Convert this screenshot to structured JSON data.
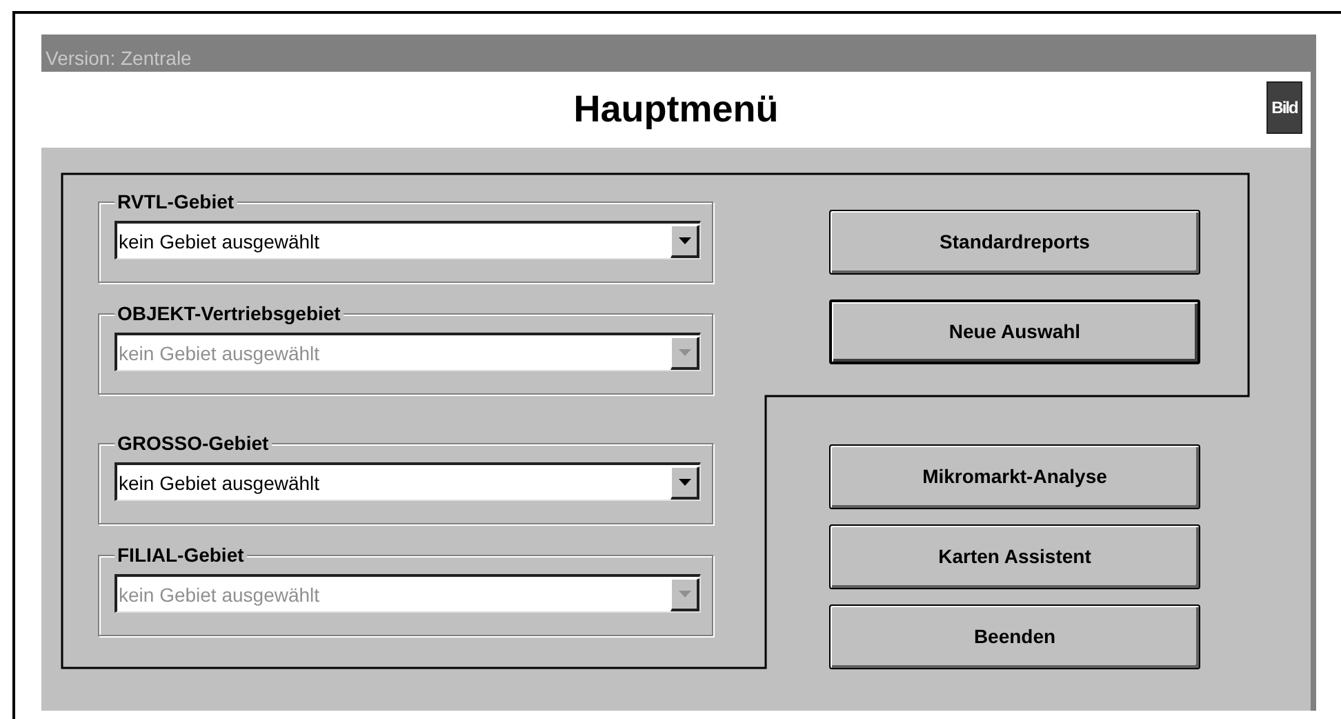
{
  "window": {
    "title": "Version: Zentrale"
  },
  "header": {
    "title": "Hauptmenü",
    "logo": "Bild"
  },
  "groups": [
    {
      "label": "RVTL-Gebiet",
      "value": "kein Gebiet ausgewählt",
      "disabled": false
    },
    {
      "label": "OBJEKT-Vertriebsgebiet",
      "value": "kein Gebiet ausgewählt",
      "disabled": true
    },
    {
      "label": "GROSSO-Gebiet",
      "value": "kein Gebiet ausgewählt",
      "disabled": false
    },
    {
      "label": "FILIAL-Gebiet",
      "value": "kein Gebiet ausgewählt",
      "disabled": true
    }
  ],
  "buttons": [
    {
      "label": "Standardreports",
      "default": false
    },
    {
      "label": "Neue Auswahl",
      "default": true
    },
    {
      "label": "Mikromarkt-Analyse",
      "default": false
    },
    {
      "label": "Karten Assistent",
      "default": false
    },
    {
      "label": "Beenden",
      "default": false
    }
  ]
}
